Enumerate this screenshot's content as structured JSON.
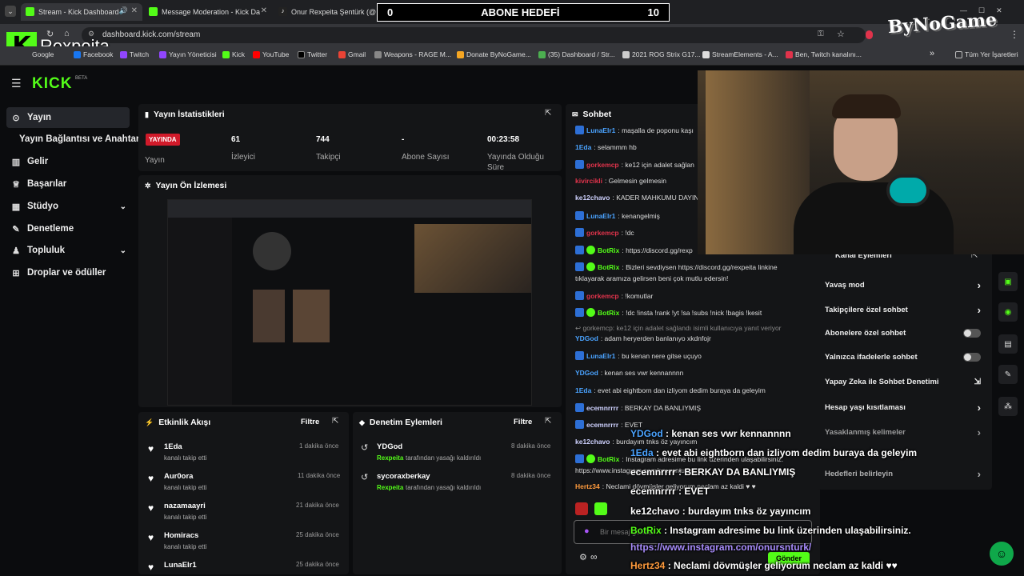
{
  "browser": {
    "tabs": [
      {
        "label": "Stream - Kick Dashboard",
        "color": "#53fc18"
      },
      {
        "label": "Message Moderation - Kick Da",
        "color": "#53fc18"
      },
      {
        "label": "Onur Rexpeita Şentürk (@rex",
        "color": "#ffffff"
      }
    ],
    "new_tab": "+",
    "url": "dashboard.kick.com/stream",
    "bookmarks": [
      "Google",
      "Facebook",
      "Twitch",
      "Yayın Yöneticisi",
      "Kick",
      "YouTube",
      "Twitter",
      "Gmail",
      "Weapons - RAGE M...",
      "Donate ByNoGame...",
      "(35) Dashboard / Str...",
      "2021 ROG Strix G17...",
      "StreamElements - A...",
      "Ben, Twitch kanalını..."
    ],
    "all_bookmarks": "Tüm Yer İşaretleri",
    "more": "»"
  },
  "overlay": {
    "goal_count_left": "0",
    "goal_title": "ABONE HEDEFİ",
    "goal_count_right": "10",
    "brand_name": "Rexpeita",
    "logo_text": "ByNoGame"
  },
  "kick": {
    "logo": "KICK",
    "beta": "BETA",
    "sidebar": [
      {
        "label": "Yayın",
        "icon": "((·))"
      },
      {
        "label": "Yayın Bağlantısı ve Anahtarı",
        "icon": ""
      },
      {
        "label": "Gelir",
        "icon": "▥"
      },
      {
        "label": "Başarılar",
        "icon": "🏆"
      },
      {
        "label": "Stüdyo",
        "icon": "▦"
      },
      {
        "label": "Denetleme",
        "icon": "🔧"
      },
      {
        "label": "Topluluk",
        "icon": "👥"
      },
      {
        "label": "Droplar ve ödüller",
        "icon": "🎁"
      }
    ],
    "stats": {
      "title": "Yayın İstatistikleri",
      "live_badge": "YAYINDA",
      "live_label": "Yayın",
      "viewers": "61",
      "viewers_label": "İzleyici",
      "followers": "744",
      "followers_label": "Takipçi",
      "subs": "-",
      "subs_label": "Abone Sayısı",
      "uptime": "00:23:58",
      "uptime_label": "Yayında Olduğu Süre"
    },
    "preview_title": "Yayın Ön İzlemesi",
    "activity": {
      "title": "Etkinlik Akışı",
      "filter": "Filtre",
      "items": [
        {
          "name": "1Eda",
          "sub": "kanalı takip etti",
          "time": "1 dakika önce"
        },
        {
          "name": "Aur0ora",
          "sub": "kanalı takip etti",
          "time": "11 dakika önce"
        },
        {
          "name": "nazamaayri",
          "sub": "kanalı takip etti",
          "time": "21 dakika önce"
        },
        {
          "name": "Homiracs",
          "sub": "kanalı takip etti",
          "time": "25 dakika önce"
        },
        {
          "name": "LunaElr1",
          "sub": "",
          "time": "25 dakika önce"
        }
      ]
    },
    "moderation": {
      "title": "Denetim Eylemleri",
      "filter": "Filtre",
      "items": [
        {
          "name": "YDGod",
          "actor": "Rexpeita",
          "sub": "tarafından yasağı kaldırıldı",
          "time": "8 dakika önce"
        },
        {
          "name": "sycoraxberkay",
          "actor": "Rexpeita",
          "sub": "tarafından yasağı kaldırıldı",
          "time": "8 dakika önce"
        }
      ]
    },
    "chat": {
      "title": "Sohbet",
      "lines": [
        {
          "user": "LunaElr1",
          "color": "#4aa3ff",
          "text": ": maşalla de poponu kaşı",
          "badge": "b"
        },
        {
          "user": "1Eda",
          "color": "#4aa3ff",
          "text": ": selammm hb",
          "badge": ""
        },
        {
          "user": "gorkemcp",
          "color": "#e0334b",
          "text": ": ke12 için adalet sağlan",
          "badge": "b"
        },
        {
          "user": "kivircikli",
          "color": "#e0334b",
          "text": ": Gelmesin gelmesin",
          "badge": ""
        },
        {
          "user": "ke12chavo",
          "color": "#cfd2ff",
          "text": ": KADER MAHKUMU DAYIN",
          "badge": ""
        },
        {
          "user": "LunaElr1",
          "color": "#4aa3ff",
          "text": ": kenangelmiş",
          "badge": "b"
        },
        {
          "user": "gorkemcp",
          "color": "#e0334b",
          "text": ": !dc",
          "badge": "b"
        },
        {
          "user": "BotRix",
          "color": "#53fc18",
          "text": ": https://discord.gg/rexp",
          "badge": "bv"
        },
        {
          "user": "BotRix",
          "color": "#53fc18",
          "text": ": Bizleri sevdiysen https://discord.gg/rexpeita linkine",
          "badge": "bv"
        },
        {
          "user": "",
          "color": "#ddd",
          "text": "tıklayarak aramıza gelirsen beni çok mutlu edersin!",
          "badge": ""
        },
        {
          "user": "gorkemcp",
          "color": "#e0334b",
          "text": ": !komutlar",
          "badge": "b"
        },
        {
          "user": "BotRix",
          "color": "#53fc18",
          "text": ": !dc !insta !rank !yt !sa !subs !nick !bagis !kesit",
          "badge": "bv"
        },
        {
          "user": "",
          "color": "#888",
          "text": "↩ gorkemcp: ke12 için adalet sağlandı isimli kullanıcıya yanıt veriyor",
          "badge": ""
        },
        {
          "user": "YDGod",
          "color": "#4aa3ff",
          "text": ": adam heryerden banlanıyo xkdnfojr",
          "badge": ""
        },
        {
          "user": "LunaElr1",
          "color": "#4aa3ff",
          "text": ": bu kenan nere gitse uçuyo",
          "badge": "b"
        },
        {
          "user": "YDGod",
          "color": "#4aa3ff",
          "text": ": kenan ses vwr kennannnn",
          "badge": ""
        },
        {
          "user": "1Eda",
          "color": "#4aa3ff",
          "text": ": evet abi eightborn dan izliyom dedim buraya da geleyim",
          "badge": ""
        },
        {
          "user": "ecemnrrrr",
          "color": "#cfd2ff",
          "text": ": BERKAY DA BANLIYMIŞ",
          "badge": "b"
        },
        {
          "user": "ecemnrrrr",
          "color": "#cfd2ff",
          "text": ": EVET",
          "badge": "b"
        },
        {
          "user": "ke12chavo",
          "color": "#cfd2ff",
          "text": ": burdayım tnks öz yayıncım",
          "badge": ""
        },
        {
          "user": "BotRix",
          "color": "#53fc18",
          "text": ": Instagram adresime bu link üzerinden ulaşabilirsiniz.",
          "badge": "bv"
        },
        {
          "user": "",
          "color": "#ddd",
          "text": "https://www.instagram.com/onursnturk/",
          "badge": ""
        },
        {
          "user": "Hertz34",
          "color": "#ff9b3d",
          "text": ": Neclami dövmüşler geliyorum neclam az kaldi ♥ ♥",
          "badge": ""
        }
      ],
      "input_placeholder": "Bir mesaj gönder",
      "send": "Gönder"
    },
    "channel_actions": {
      "title": "Kanal Eylemleri",
      "items": [
        {
          "label": "Yavaş mod",
          "type": "arrow"
        },
        {
          "label": "Takipçilere özel sohbet",
          "type": "arrow"
        },
        {
          "label": "Abonelere özel sohbet",
          "type": "toggle"
        },
        {
          "label": "Yalnızca ifadelerle sohbet",
          "type": "toggle"
        },
        {
          "label": "Yapay Zeka ile Sohbet Denetimi",
          "type": "ext"
        },
        {
          "label": "Hesap yaşı kısıtlaması",
          "type": "arrow"
        },
        {
          "label": "Yasaklanmış kelimeler",
          "type": "arrow"
        },
        {
          "label": "Hedefleri belirleyin",
          "type": "arrow"
        }
      ]
    }
  },
  "overlay_chat": [
    {
      "user": "YDGod",
      "color": "#4aa3ff",
      "text": " : kenan ses vwr kennannnn"
    },
    {
      "user": "1Eda",
      "color": "#4aa3ff",
      "text": " : evet abi eightborn dan izliyom dedim buraya da geleyim"
    },
    {
      "user": "ecemnrrrr",
      "color": "#ffffff",
      "text": " : BERKAY DA BANLIYMIŞ"
    },
    {
      "user": "ecemnrrrr",
      "color": "#ffffff",
      "text": " : EVET"
    },
    {
      "user": "ke12chavo",
      "color": "#ffffff",
      "text": " : burdayım tnks öz yayıncım"
    },
    {
      "user": "BotRix",
      "color": "#53fc18",
      "text": " : Instagram adresime bu link üzerinden ulaşabilirsiniz."
    },
    {
      "user": "",
      "color": "#a78bfa",
      "text": "https://www.instagram.com/onursnturk/"
    },
    {
      "user": "Hertz34",
      "color": "#ff9b3d",
      "text": " : Neclami dövmüşler geliyorum neclam az kaldi ♥♥"
    }
  ]
}
